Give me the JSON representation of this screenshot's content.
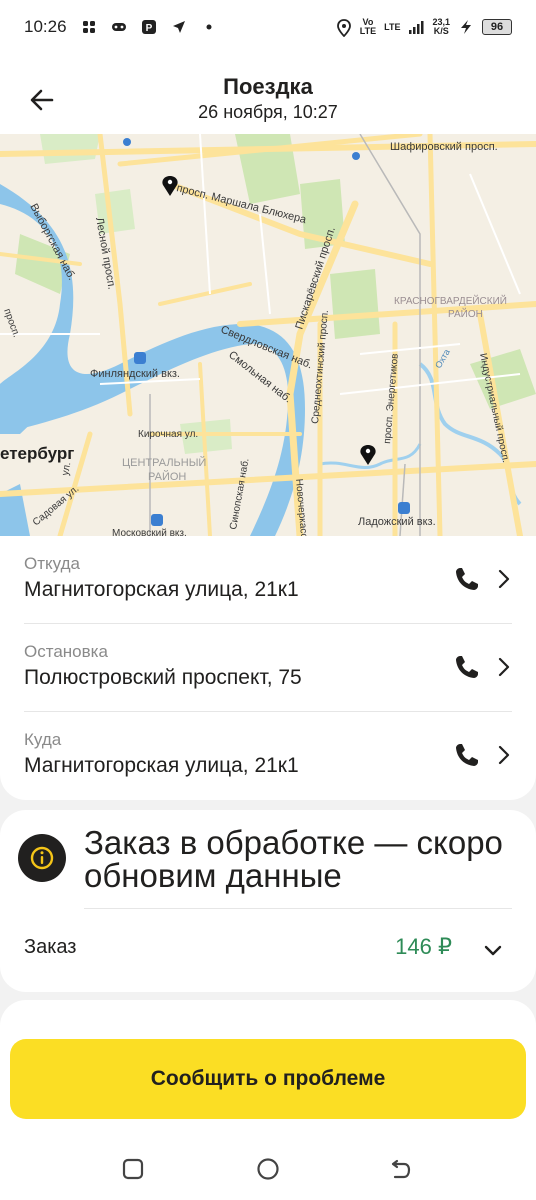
{
  "status_bar": {
    "time": "10:26",
    "network_1": "Vo",
    "network_1b": "LTE",
    "network_2": "LTE",
    "speed_value": "23,1",
    "speed_unit": "K/S",
    "battery": "96"
  },
  "header": {
    "title": "Поездка",
    "subtitle": "26 ноября, 10:27"
  },
  "map": {
    "labels": {
      "shafirovsky": "Шафировский просп.",
      "blucher": "просп. Маршала Блюхера",
      "vyborgskaya": "Выборгская наб.",
      "lesnoy": "Лесной просп.",
      "piskarevsky": "Пискарёвский просп.",
      "krasnogvardeysky_1": "КРАСНОГВАРДЕЙСКИЙ",
      "krasnogvardeysky_2": "РАЙОН",
      "sverdlovskaya": "Свердловская наб.",
      "smolnaya": "Смольная наб.",
      "finlyandsky": "Финляндский вкз.",
      "sredneokhtinsky": "Среднеохтинский просп.",
      "energetikov": "просп. Энергетиков",
      "industrialny": "Индустриальный просп.",
      "okhta": "Охта",
      "kirochnaya": "Кирочная ул.",
      "peterburg": "етербург",
      "centralny_1": "ЦЕНТРАЛЬНЫЙ",
      "centralny_2": "РАЙОН",
      "sinopskaya": "Синопская наб.",
      "novocherkassky": "Новочеркасский",
      "ladozhsky": "Ладожский вкз.",
      "sadovaya": "Садовая ул.",
      "moskovsky": "Московский вкз.",
      "prosp_left": "просп.",
      "ul_left": "ул."
    }
  },
  "route": {
    "stops": [
      {
        "label": "Откуда",
        "address": "Магнитогорская улица, 21к1"
      },
      {
        "label": "Остановка",
        "address": "Полюстровский проспект, 75"
      },
      {
        "label": "Куда",
        "address": "Магнитогорская улица, 21к1"
      }
    ]
  },
  "order_status": {
    "message": "Заказ в обработке — скоро обновим данные",
    "order_label": "Заказ",
    "price": "146 ₽"
  },
  "actions": {
    "report_problem": "Сообщить о проблеме"
  },
  "colors": {
    "accent_yellow": "#fbde24",
    "price_green": "#2e8b57",
    "water": "#8dc5ea",
    "park": "#cfe6b4",
    "road": "#fde39a"
  },
  "icons": {
    "back": "arrow-left-icon",
    "phone": "phone-icon",
    "chevron": "chevron-right-icon",
    "info": "info-icon",
    "expand": "chevron-down-icon",
    "pin": "map-pin-icon"
  }
}
